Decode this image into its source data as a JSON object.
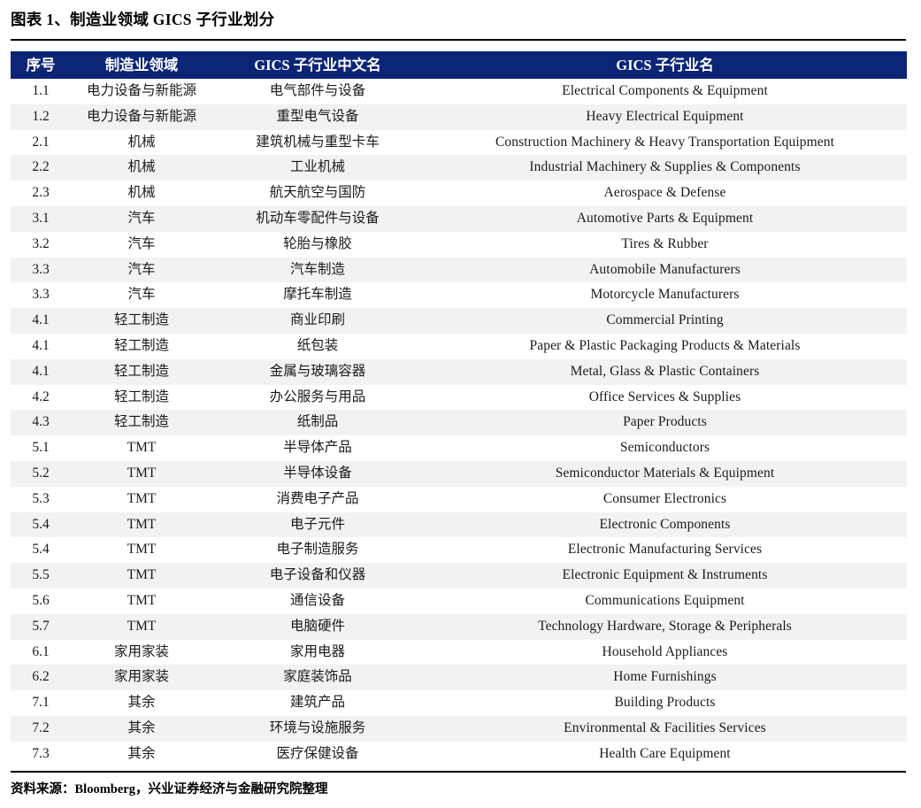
{
  "title": "图表 1、制造业领域 GICS 子行业划分",
  "colors": {
    "header_bg": "#0d2577",
    "header_text": "#ffffff",
    "row_alt_bg": "#f2f2f2",
    "row_bg": "#ffffff",
    "rule": "#000000"
  },
  "table": {
    "columns": [
      "序号",
      "制造业领域",
      "GICS 子行业中文名",
      "GICS 子行业名"
    ],
    "rows": [
      [
        "1.1",
        "电力设备与新能源",
        "电气部件与设备",
        "Electrical Components & Equipment"
      ],
      [
        "1.2",
        "电力设备与新能源",
        "重型电气设备",
        "Heavy Electrical Equipment"
      ],
      [
        "2.1",
        "机械",
        "建筑机械与重型卡车",
        "Construction Machinery & Heavy Transportation Equipment"
      ],
      [
        "2.2",
        "机械",
        "工业机械",
        "Industrial Machinery & Supplies & Components"
      ],
      [
        "2.3",
        "机械",
        "航天航空与国防",
        "Aerospace & Defense"
      ],
      [
        "3.1",
        "汽车",
        "机动车零配件与设备",
        "Automotive Parts & Equipment"
      ],
      [
        "3.2",
        "汽车",
        "轮胎与橡胶",
        "Tires & Rubber"
      ],
      [
        "3.3",
        "汽车",
        "汽车制造",
        "Automobile Manufacturers"
      ],
      [
        "3.3",
        "汽车",
        "摩托车制造",
        "Motorcycle Manufacturers"
      ],
      [
        "4.1",
        "轻工制造",
        "商业印刷",
        "Commercial Printing"
      ],
      [
        "4.1",
        "轻工制造",
        "纸包装",
        "Paper & Plastic Packaging Products & Materials"
      ],
      [
        "4.1",
        "轻工制造",
        "金属与玻璃容器",
        "Metal, Glass & Plastic Containers"
      ],
      [
        "4.2",
        "轻工制造",
        "办公服务与用品",
        "Office Services & Supplies"
      ],
      [
        "4.3",
        "轻工制造",
        "纸制品",
        "Paper Products"
      ],
      [
        "5.1",
        "TMT",
        "半导体产品",
        "Semiconductors"
      ],
      [
        "5.2",
        "TMT",
        "半导体设备",
        "Semiconductor Materials & Equipment"
      ],
      [
        "5.3",
        "TMT",
        "消费电子产品",
        "Consumer Electronics"
      ],
      [
        "5.4",
        "TMT",
        "电子元件",
        "Electronic Components"
      ],
      [
        "5.4",
        "TMT",
        "电子制造服务",
        "Electronic Manufacturing Services"
      ],
      [
        "5.5",
        "TMT",
        "电子设备和仪器",
        "Electronic Equipment & Instruments"
      ],
      [
        "5.6",
        "TMT",
        "通信设备",
        "Communications Equipment"
      ],
      [
        "5.7",
        "TMT",
        "电脑硬件",
        "Technology Hardware, Storage & Peripherals"
      ],
      [
        "6.1",
        "家用家装",
        "家用电器",
        "Household Appliances"
      ],
      [
        "6.2",
        "家用家装",
        "家庭装饰品",
        "Home Furnishings"
      ],
      [
        "7.1",
        "其余",
        "建筑产品",
        "Building Products"
      ],
      [
        "7.2",
        "其余",
        "环境与设施服务",
        "Environmental & Facilities Services"
      ],
      [
        "7.3",
        "其余",
        "医疗保健设备",
        "Health Care Equipment"
      ]
    ]
  },
  "footer": {
    "source_note": "资料来源：Bloomberg，兴业证券经济与金融研究院整理"
  }
}
